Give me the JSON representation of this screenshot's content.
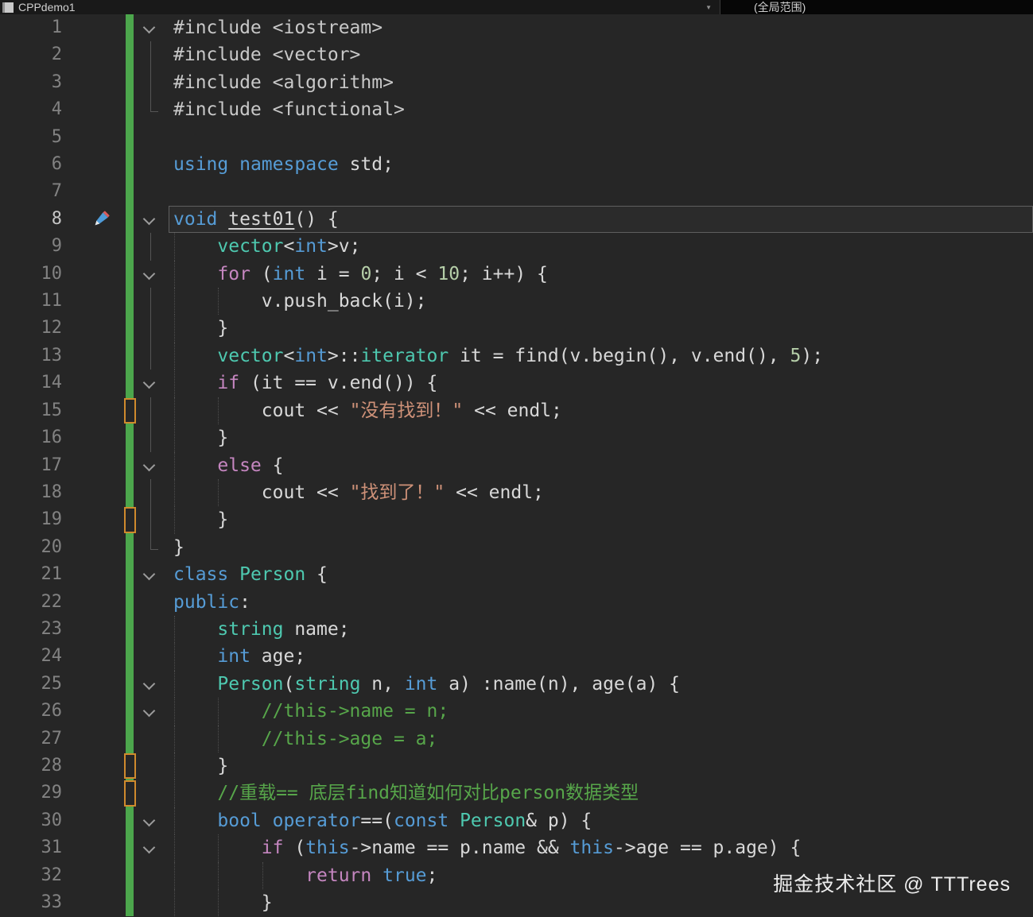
{
  "title_bar": {
    "project": "CPPdemo1",
    "scope": "(全局范围)"
  },
  "watermark": "掘金技术社区 @ TTTrees",
  "palette": {
    "keyword": "#569CD6",
    "control": "#C586C0",
    "type": "#4EC9B0",
    "string": "#CE9178",
    "comment": "#57A64A",
    "number": "#B5CEA8",
    "plain": "#D8D8D8",
    "preprocessor": "#C8C8C8",
    "gutter_added_green": "#4CA64C",
    "gutter_mark_orange": "#CF8A2D"
  },
  "editor": {
    "current_line": 8,
    "lines": [
      {
        "n": 1,
        "fold": true,
        "t": [
          [
            "#include <iostream>",
            "pp"
          ]
        ]
      },
      {
        "n": 2,
        "fl": "v",
        "t": [
          [
            "#include <vector>",
            "pp"
          ]
        ]
      },
      {
        "n": 3,
        "fl": "v",
        "t": [
          [
            "#include <algorithm>",
            "pp"
          ]
        ]
      },
      {
        "n": 4,
        "fl": "c",
        "t": [
          [
            "#include <functional>",
            "pp"
          ]
        ]
      },
      {
        "n": 5,
        "t": []
      },
      {
        "n": 6,
        "t": [
          [
            "using",
            "kw"
          ],
          [
            " ",
            "pl"
          ],
          [
            "namespace",
            "kw"
          ],
          [
            " std;",
            "pl"
          ]
        ]
      },
      {
        "n": 7,
        "t": []
      },
      {
        "n": 8,
        "fold": true,
        "icon": "pen",
        "t": [
          [
            "void",
            "kw"
          ],
          [
            " ",
            "pl"
          ],
          [
            "test01",
            "pl u"
          ],
          [
            "() {",
            "pl"
          ]
        ]
      },
      {
        "n": 9,
        "fl": "v",
        "g": [
          0
        ],
        "t": [
          [
            "    ",
            "pl"
          ],
          [
            "vector",
            "ty"
          ],
          [
            "<",
            "pl"
          ],
          [
            "int",
            "kw"
          ],
          [
            ">v;",
            "pl"
          ]
        ]
      },
      {
        "n": 10,
        "fold": true,
        "g": [
          0
        ],
        "t": [
          [
            "    ",
            "pl"
          ],
          [
            "for",
            "ctl"
          ],
          [
            " (",
            "pl"
          ],
          [
            "int",
            "kw"
          ],
          [
            " i = ",
            "pl"
          ],
          [
            "0",
            "num"
          ],
          [
            "; i < ",
            "pl"
          ],
          [
            "10",
            "num"
          ],
          [
            "; i++) {",
            "pl"
          ]
        ]
      },
      {
        "n": 11,
        "fl": "v",
        "g": [
          0,
          1
        ],
        "t": [
          [
            "        v.push_back(i);",
            "pl"
          ]
        ]
      },
      {
        "n": 12,
        "fl": "v",
        "g": [
          0
        ],
        "t": [
          [
            "    }",
            "pl"
          ]
        ]
      },
      {
        "n": 13,
        "fl": "v",
        "g": [
          0
        ],
        "t": [
          [
            "    ",
            "pl"
          ],
          [
            "vector",
            "ty"
          ],
          [
            "<",
            "pl"
          ],
          [
            "int",
            "kw"
          ],
          [
            ">::",
            "pl"
          ],
          [
            "iterator",
            "ty"
          ],
          [
            " it = find(v.begin(), v.end(), ",
            "pl"
          ],
          [
            "5",
            "num"
          ],
          [
            ");",
            "pl"
          ]
        ]
      },
      {
        "n": 14,
        "fold": true,
        "g": [
          0
        ],
        "t": [
          [
            "    ",
            "pl"
          ],
          [
            "if",
            "ctl"
          ],
          [
            " (it == v.end()) {",
            "pl"
          ]
        ]
      },
      {
        "n": 15,
        "fl": "v",
        "g": [
          0,
          1
        ],
        "m": "orange",
        "t": [
          [
            "        cout << ",
            "pl"
          ],
          [
            "\"没有找到！\"",
            "str"
          ],
          [
            " << endl;",
            "pl"
          ]
        ]
      },
      {
        "n": 16,
        "fl": "v",
        "g": [
          0
        ],
        "t": [
          [
            "    }",
            "pl"
          ]
        ]
      },
      {
        "n": 17,
        "fold": true,
        "g": [
          0
        ],
        "t": [
          [
            "    ",
            "pl"
          ],
          [
            "else",
            "ctl"
          ],
          [
            " {",
            "pl"
          ]
        ]
      },
      {
        "n": 18,
        "fl": "v",
        "g": [
          0,
          1
        ],
        "t": [
          [
            "        cout << ",
            "pl"
          ],
          [
            "\"找到了！\"",
            "str"
          ],
          [
            " << endl;",
            "pl"
          ]
        ]
      },
      {
        "n": 19,
        "fl": "v",
        "g": [
          0
        ],
        "m": "orange",
        "t": [
          [
            "    }",
            "pl"
          ]
        ]
      },
      {
        "n": 20,
        "fl": "c",
        "t": [
          [
            "}",
            "pl"
          ]
        ]
      },
      {
        "n": 21,
        "fold": true,
        "t": [
          [
            "class",
            "kw"
          ],
          [
            " ",
            "pl"
          ],
          [
            "Person",
            "ty"
          ],
          [
            " {",
            "pl"
          ]
        ]
      },
      {
        "n": 22,
        "t": [
          [
            "public",
            "kw"
          ],
          [
            ":",
            "pl"
          ]
        ]
      },
      {
        "n": 23,
        "g": [
          0
        ],
        "t": [
          [
            "    ",
            "pl"
          ],
          [
            "string",
            "ty"
          ],
          [
            " name;",
            "pl"
          ]
        ]
      },
      {
        "n": 24,
        "g": [
          0
        ],
        "t": [
          [
            "    ",
            "pl"
          ],
          [
            "int",
            "kw"
          ],
          [
            " age;",
            "pl"
          ]
        ]
      },
      {
        "n": 25,
        "fold": true,
        "g": [
          0
        ],
        "t": [
          [
            "    ",
            "pl"
          ],
          [
            "Person",
            "ty"
          ],
          [
            "(",
            "pl"
          ],
          [
            "string",
            "ty"
          ],
          [
            " n, ",
            "pl"
          ],
          [
            "int",
            "kw"
          ],
          [
            " a) :name(n), age(a) {",
            "pl"
          ]
        ]
      },
      {
        "n": 26,
        "fold": true,
        "g": [
          0,
          1
        ],
        "t": [
          [
            "        ",
            "pl"
          ],
          [
            "//this->name = n;",
            "com"
          ]
        ]
      },
      {
        "n": 27,
        "g": [
          0,
          1
        ],
        "t": [
          [
            "        ",
            "pl"
          ],
          [
            "//this->age = a;",
            "com"
          ]
        ]
      },
      {
        "n": 28,
        "g": [
          0
        ],
        "m": "orange",
        "t": [
          [
            "    }",
            "pl"
          ]
        ]
      },
      {
        "n": 29,
        "g": [
          0
        ],
        "m": "orange",
        "t": [
          [
            "    ",
            "pl"
          ],
          [
            "//重载== 底层find知道如何对比person数据类型",
            "com"
          ]
        ]
      },
      {
        "n": 30,
        "fold": true,
        "g": [
          0
        ],
        "t": [
          [
            "    ",
            "pl"
          ],
          [
            "bool",
            "kw"
          ],
          [
            " ",
            "pl"
          ],
          [
            "operator",
            "kw"
          ],
          [
            "==(",
            "pl"
          ],
          [
            "const",
            "kw"
          ],
          [
            " ",
            "pl"
          ],
          [
            "Person",
            "ty"
          ],
          [
            "& p) {",
            "pl"
          ]
        ]
      },
      {
        "n": 31,
        "fold": true,
        "g": [
          0,
          1
        ],
        "t": [
          [
            "        ",
            "pl"
          ],
          [
            "if",
            "ctl"
          ],
          [
            " (",
            "pl"
          ],
          [
            "this",
            "kw"
          ],
          [
            "->name == p.name && ",
            "pl"
          ],
          [
            "this",
            "kw"
          ],
          [
            "->age == p.age) {",
            "pl"
          ]
        ]
      },
      {
        "n": 32,
        "g": [
          0,
          1,
          2
        ],
        "t": [
          [
            "            ",
            "pl"
          ],
          [
            "return",
            "ctl"
          ],
          [
            " ",
            "pl"
          ],
          [
            "true",
            "kw"
          ],
          [
            ";",
            "pl"
          ]
        ]
      },
      {
        "n": 33,
        "g": [
          0,
          1
        ],
        "t": [
          [
            "        }",
            "pl"
          ]
        ]
      }
    ]
  }
}
